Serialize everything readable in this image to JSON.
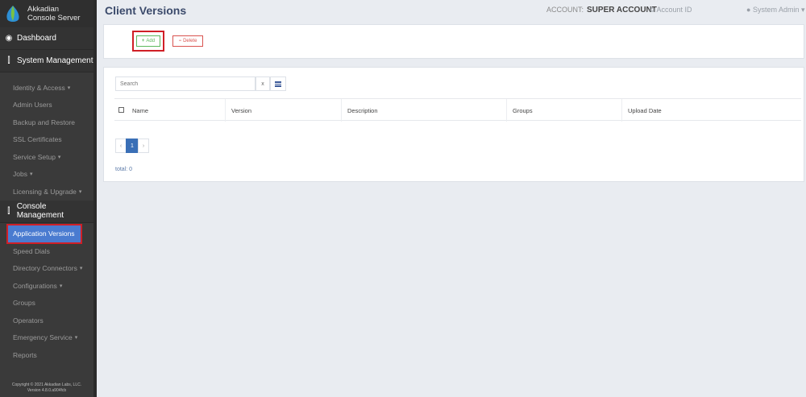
{
  "app": {
    "brand_line1": "Akkadian",
    "brand_line2": "Console Server",
    "footer_line1": "Copyright © 2021 Akkadian Labs, LLC.",
    "footer_line2": "Version 4.8.0.a904fcb"
  },
  "header": {
    "title": "Client Versions",
    "account_prefix": "ACCOUNT:",
    "account_name": "SUPER ACCOUNT",
    "account_id": "Account ID",
    "user": "System Admin"
  },
  "sidebar": {
    "dashboard": "Dashboard",
    "system_management": "System Management",
    "system_items": [
      {
        "label": "Identity & Access",
        "caret": true
      },
      {
        "label": "Admin Users"
      },
      {
        "label": "Backup and Restore"
      },
      {
        "label": "SSL Certificates"
      },
      {
        "label": "Service Setup",
        "caret": true
      },
      {
        "label": "Jobs",
        "caret": true
      },
      {
        "label": "Licensing & Upgrade",
        "caret": true
      }
    ],
    "console_management": "Console Management",
    "console_items": [
      {
        "label": "Application Versions",
        "active": true
      },
      {
        "label": "Speed Dials"
      },
      {
        "label": "Directory Connectors",
        "caret": true
      },
      {
        "label": "Configurations",
        "caret": true
      },
      {
        "label": "Groups"
      },
      {
        "label": "Operators"
      },
      {
        "label": "Emergency Service",
        "caret": true
      },
      {
        "label": "Reports"
      }
    ]
  },
  "toolbar": {
    "add_label": "Add",
    "delete_label": "Delete"
  },
  "search": {
    "placeholder": "Search",
    "clear_label": "x"
  },
  "table": {
    "columns": [
      "Name",
      "Version",
      "Description",
      "Groups",
      "Upload Date"
    ]
  },
  "pagination": {
    "prev": "‹",
    "current": "1",
    "next": "›",
    "total": "total: 0"
  },
  "colors": {
    "sidebar_bg": "#3a3a3a",
    "active_item": "#4a7bd0",
    "highlight_red": "#d01f26",
    "title": "#3b4a6b"
  }
}
